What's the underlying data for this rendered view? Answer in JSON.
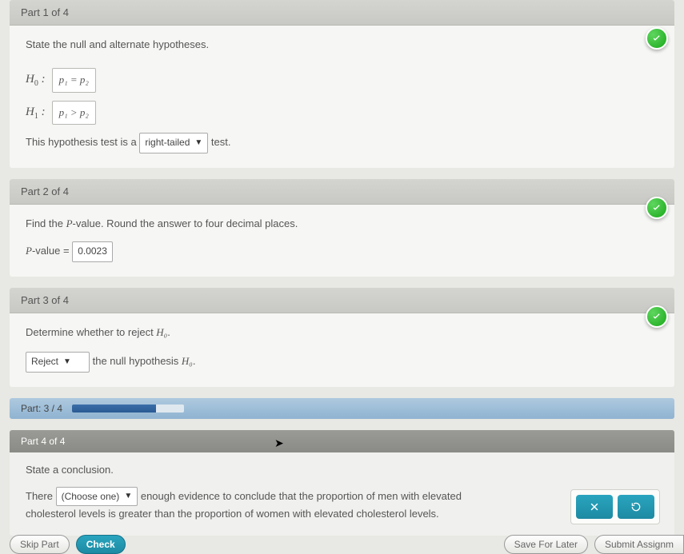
{
  "parts": {
    "p1": {
      "header": "Part 1 of 4",
      "prompt": "State the null and alternate hypotheses.",
      "h0_label": "H",
      "h0_sub": "0",
      "h0_box": "p₁ = p₂",
      "h1_label": "H",
      "h1_sub": "1",
      "h1_box": "p₁ > p₂",
      "tail_pre": "This hypothesis test is a",
      "tail_select": "right-tailed",
      "tail_post": "test."
    },
    "p2": {
      "header": "Part 2 of 4",
      "prompt": "Find the P-value. Round the answer to four decimal places.",
      "pv_label": "P-value =",
      "pv_value": "0.0023"
    },
    "p3": {
      "header": "Part 3 of 4",
      "prompt_pre": "Determine whether to reject ",
      "prompt_math": "H₀",
      "prompt_post": ".",
      "reject_select": "Reject",
      "reject_post_pre": "the null hypothesis ",
      "reject_post_math": "H₀",
      "reject_post_post": "."
    },
    "progress": {
      "label": "Part: 3 / 4",
      "percent": 75
    },
    "p4": {
      "header": "Part 4 of 4",
      "prompt": "State a conclusion.",
      "c_pre": "There",
      "c_select": "(Choose one)",
      "c_post": "enough evidence to conclude that the proportion of men with elevated cholesterol levels is greater than the proportion of women with elevated cholesterol levels."
    }
  },
  "footer": {
    "skip": "Skip Part",
    "check": "Check",
    "save": "Save For Later",
    "submit": "Submit Assignm"
  }
}
